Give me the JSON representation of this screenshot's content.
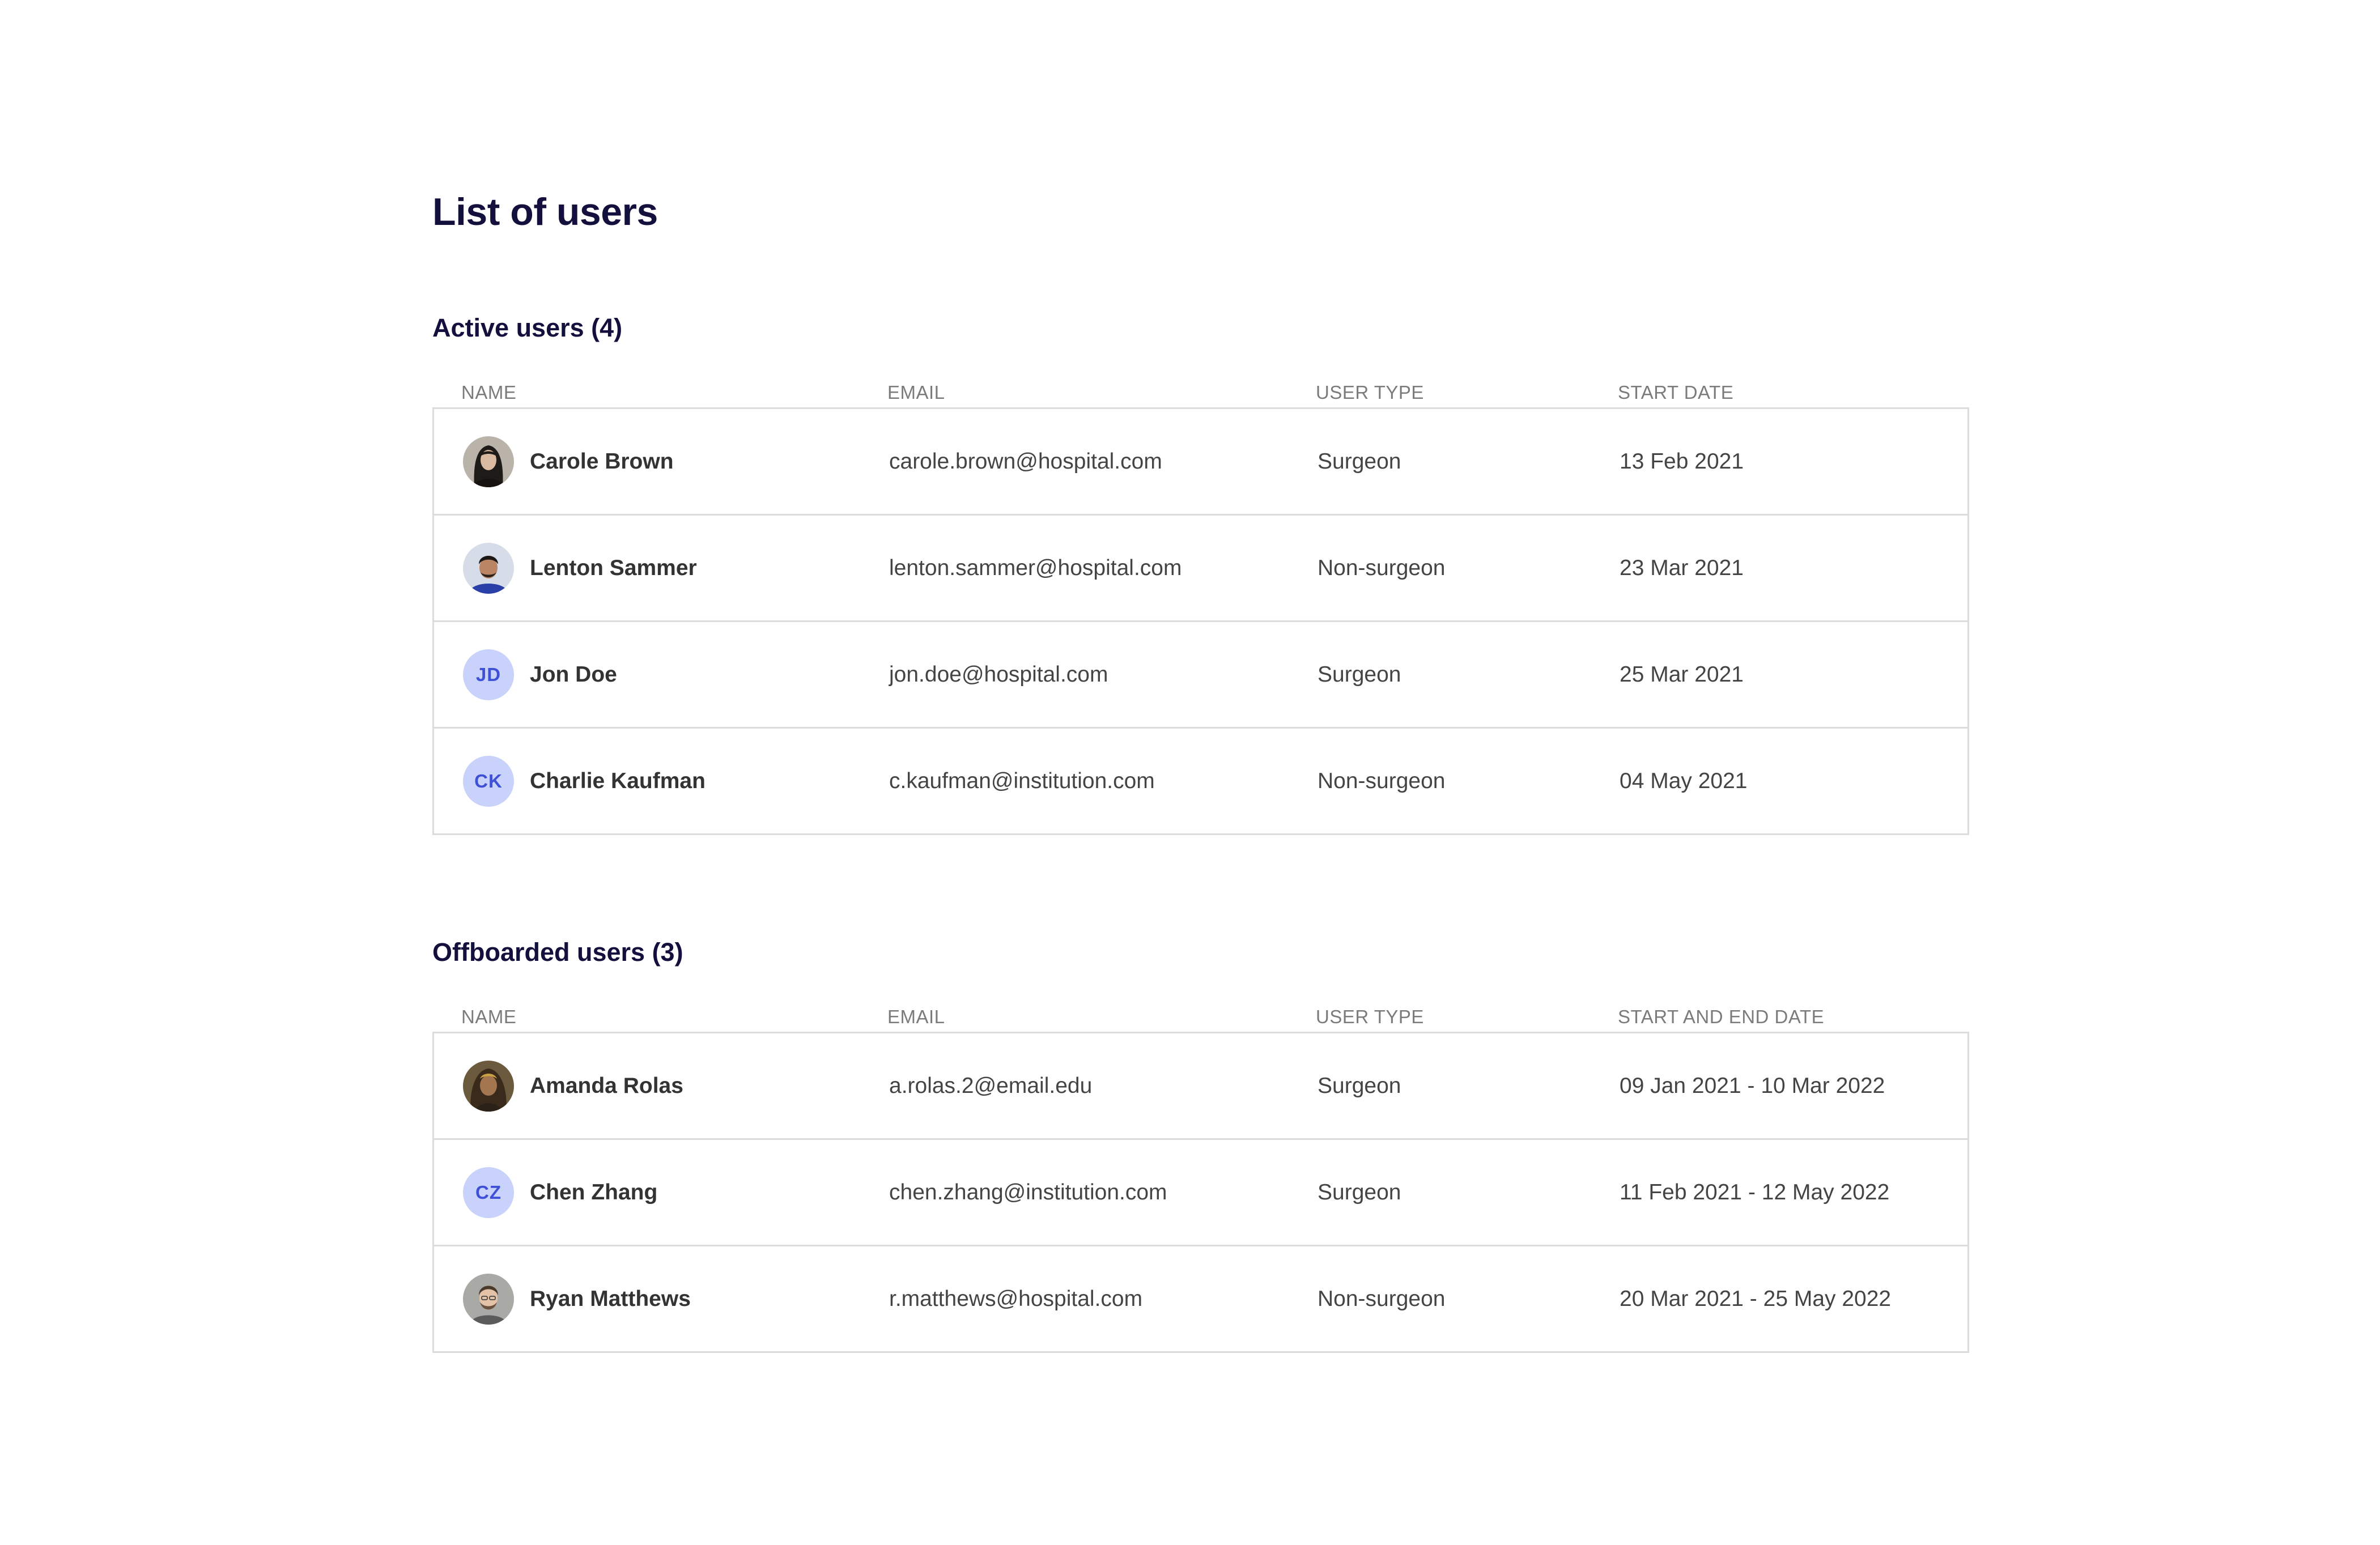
{
  "page": {
    "title": "List of users"
  },
  "active": {
    "title": "Active users (4)",
    "columns": [
      "NAME",
      "EMAIL",
      "USER TYPE",
      "START DATE"
    ],
    "rows": [
      {
        "name": "Carole Brown",
        "email": "carole.brown@hospital.com",
        "type": "Surgeon",
        "date": "13 Feb 2021",
        "avatar": "photo"
      },
      {
        "name": "Lenton Sammer",
        "email": "lenton.sammer@hospital.com",
        "type": "Non-surgeon",
        "date": "23 Mar 2021",
        "avatar": "photo"
      },
      {
        "name": "Jon Doe",
        "email": "jon.doe@hospital.com",
        "type": "Surgeon",
        "date": "25 Mar 2021",
        "avatar": "JD"
      },
      {
        "name": "Charlie Kaufman",
        "email": "c.kaufman@institution.com",
        "type": "Non-surgeon",
        "date": "04 May 2021",
        "avatar": "CK"
      }
    ]
  },
  "offboarded": {
    "title": "Offboarded users (3)",
    "columns": [
      "NAME",
      "EMAIL",
      "USER TYPE",
      "START AND END DATE"
    ],
    "rows": [
      {
        "name": "Amanda Rolas",
        "email": "a.rolas.2@email.edu",
        "type": "Surgeon",
        "date": "09 Jan 2021 - 10 Mar 2022",
        "avatar": "photo"
      },
      {
        "name": "Chen Zhang",
        "email": "chen.zhang@institution.com",
        "type": "Surgeon",
        "date": "11 Feb 2021 - 12 May 2022",
        "avatar": "CZ"
      },
      {
        "name": "Ryan Matthews",
        "email": "r.matthews@hospital.com",
        "type": "Non-surgeon",
        "date": "20 Mar 2021 - 25 May 2022",
        "avatar": "photo"
      }
    ]
  },
  "colors": {
    "heading": "#14103d",
    "avatar_bg": "#c8d2fb",
    "avatar_text": "#3e50d8",
    "border": "#dcdcdc"
  }
}
